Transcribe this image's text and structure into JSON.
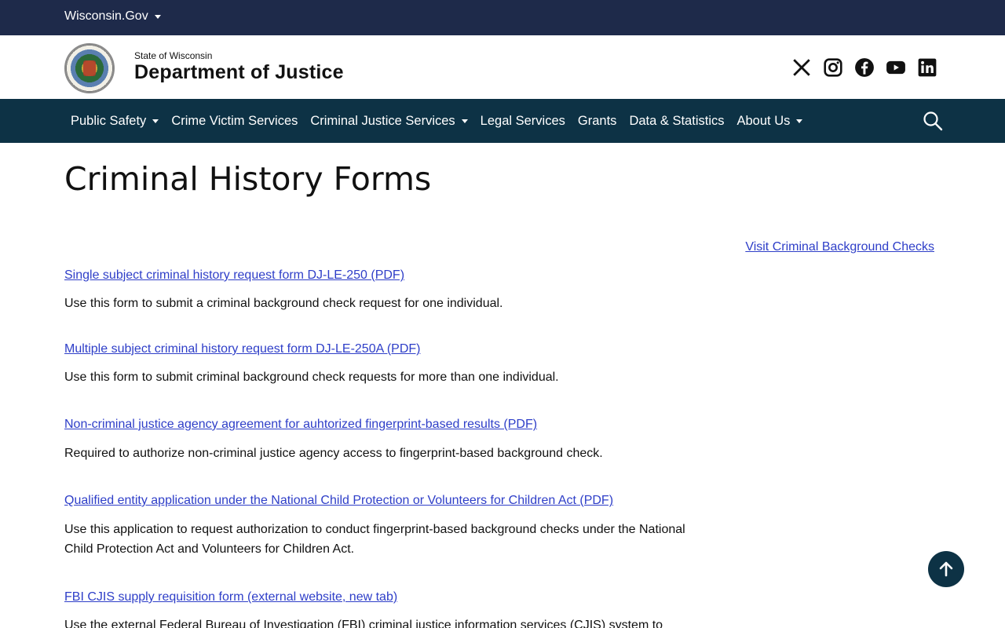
{
  "topbar": {
    "gov_label": "Wisconsin.Gov"
  },
  "header": {
    "small_title": "State of Wisconsin",
    "big_title": "Department of Justice",
    "social": [
      "x-icon",
      "instagram-icon",
      "facebook-icon",
      "youtube-icon",
      "linkedin-icon"
    ]
  },
  "nav": {
    "items": [
      {
        "label": "Public Safety",
        "dropdown": true
      },
      {
        "label": "Crime Victim Services",
        "dropdown": false
      },
      {
        "label": "Criminal Justice Services",
        "dropdown": true
      },
      {
        "label": "Legal Services",
        "dropdown": false
      },
      {
        "label": "Grants",
        "dropdown": false
      },
      {
        "label": "Data & Statistics",
        "dropdown": false
      },
      {
        "label": "About Us",
        "dropdown": true
      }
    ]
  },
  "page": {
    "title": "Criminal History Forms",
    "visit_link": "Visit Criminal Background Checks",
    "forms": [
      {
        "link": "Single subject criminal history request form DJ-LE-250 (PDF)",
        "desc": "Use this form to submit a criminal background check request for one individual."
      },
      {
        "link": "Multiple subject criminal history request form DJ-LE-250A (PDF)",
        "desc": "Use this form to submit criminal background check requests for more than one individual."
      },
      {
        "link": "Non-criminal justice agency agreement for auhtorized fingerprint-based results (PDF)",
        "desc": "Required to authorize non-criminal justice agency access to fingerprint-based background check."
      },
      {
        "link": "Qualified entity application under the National Child Protection or Volunteers for Children Act (PDF)",
        "desc": "Use this application to request authorization to conduct fingerprint-based background checks under the National Child Protection Act and Volunteers for Children Act."
      },
      {
        "link": "FBI CJIS supply requisition form (external website, new tab)",
        "desc": "Use the external Federal Bureau of Investigation (FBI) criminal justice information services (CJIS) system to"
      }
    ]
  },
  "colors": {
    "topbar": "#1e2a4a",
    "nav": "#0d3245",
    "link": "#2e3ec8"
  }
}
